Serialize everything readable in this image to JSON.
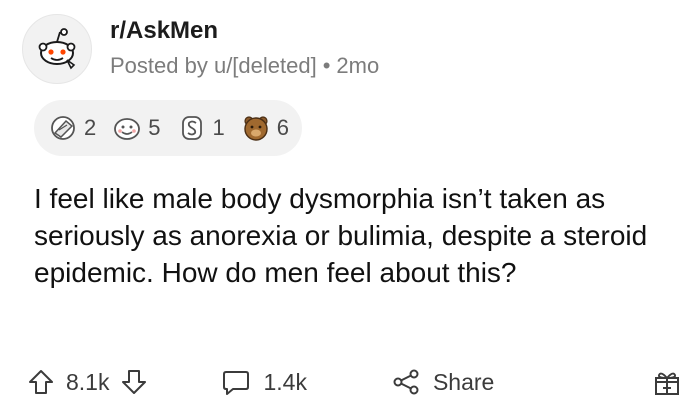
{
  "post": {
    "subreddit": "r/AskMen",
    "posted_by": "Posted by u/[deleted]",
    "separator": "•",
    "age": "2mo",
    "title": "I feel like male body dysmorphia isn’t taken as seriously as anorexia or bulimia, despite a steroid epidemic. How do men feel about this?"
  },
  "awards": [
    {
      "icon": "facepalm-award-icon",
      "count": "2"
    },
    {
      "icon": "wholesome-award-icon",
      "count": "5"
    },
    {
      "icon": "silver-award-icon",
      "count": "1"
    },
    {
      "icon": "bear-award-icon",
      "count": "6"
    }
  ],
  "actions": {
    "upvotes": "8.1k",
    "comments": "1.4k",
    "share_label": "Share"
  },
  "colors": {
    "snoo_orange": "#ff4500",
    "muted_text": "#7c7c7c",
    "award_bg": "#f2f2f2"
  }
}
